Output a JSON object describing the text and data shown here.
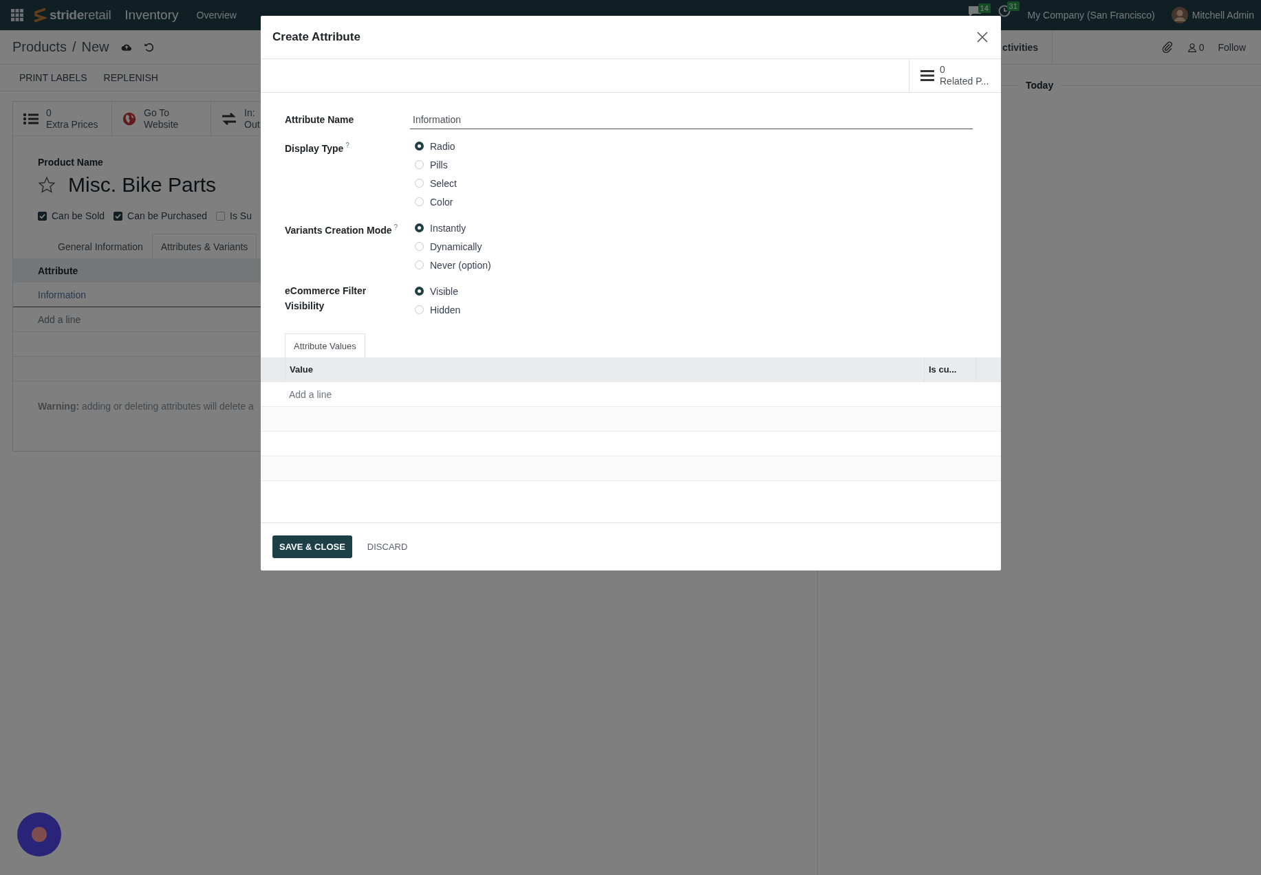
{
  "navbar": {
    "brand": "**stride**retail",
    "app_name": "Inventory",
    "menu": [
      "Overview"
    ],
    "messages_badge": "14",
    "activities_badge": "31",
    "company": "My Company (San Francisco)",
    "user": "Mitchell Admin"
  },
  "control_panel": {
    "breadcrumb": [
      "Products",
      "New"
    ],
    "separator": "/",
    "actions": [
      "PRINT LABELS",
      "REPLENISH"
    ]
  },
  "stat_buttons": [
    {
      "kind": "count",
      "value": "0",
      "label": "Extra Prices"
    },
    {
      "kind": "text",
      "lines": [
        "Go To",
        "Website"
      ]
    },
    {
      "kind": "text",
      "lines": [
        "In:",
        "Out"
      ]
    }
  ],
  "product": {
    "name_label": "Product Name",
    "name": "Misc. Bike Parts",
    "favorite": false,
    "options": [
      {
        "label": "Can be Sold",
        "checked": true
      },
      {
        "label": "Can be Purchased",
        "checked": true
      },
      {
        "label": "Is Su",
        "checked": false
      }
    ]
  },
  "tabs": [
    {
      "label": "General Information",
      "selected": false
    },
    {
      "label": "Attributes & Variants",
      "selected": true
    }
  ],
  "attribute_table": {
    "column": "Attribute",
    "rows": [
      "Information"
    ],
    "add_line": "Add a line"
  },
  "warning": "**Warning:** adding or deleting attributes will delete a",
  "chatter": {
    "activities": "ctivities",
    "followers": "0",
    "follow": "Follow",
    "date_separator": "Today"
  },
  "dialog": {
    "title": "Create Attribute",
    "stat": {
      "value": "0",
      "label": "Related P..."
    },
    "fields": [
      {
        "kind": "text",
        "label": "Attribute Name",
        "value": "Information"
      },
      {
        "kind": "radio",
        "label": "Display Type",
        "help": "?",
        "options": [
          {
            "label": "Radio",
            "selected": true
          },
          {
            "label": "Pills",
            "selected": false
          },
          {
            "label": "Select",
            "selected": false
          },
          {
            "label": "Color",
            "selected": false
          }
        ]
      },
      {
        "kind": "radio",
        "label": "Variants Creation Mode",
        "help": "?",
        "options": [
          {
            "label": "Instantly",
            "selected": true
          },
          {
            "label": "Dynamically",
            "selected": false
          },
          {
            "label": "Never (option)",
            "selected": false
          }
        ]
      },
      {
        "kind": "radio",
        "label": "eCommerce Filter Visibility",
        "options": [
          {
            "label": "Visible",
            "selected": true
          },
          {
            "label": "Hidden",
            "selected": false
          }
        ]
      }
    ],
    "tab": "Attribute Values",
    "columns": [
      "Value",
      "Is cu..."
    ],
    "add_line": "Add a line",
    "buttons": [
      {
        "kind": "primary",
        "label": "SAVE & CLOSE"
      },
      {
        "kind": "link",
        "label": "DISCARD"
      }
    ]
  }
}
